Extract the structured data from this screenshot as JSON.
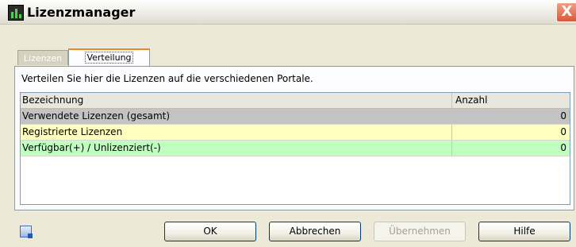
{
  "window": {
    "title": "Lizenzmanager",
    "close_label": "X"
  },
  "tabs": [
    {
      "label": "Lizenzen",
      "active": false
    },
    {
      "label": "Verteilung",
      "active": true
    }
  ],
  "panel": {
    "description": "Verteilen Sie hier die Lizenzen auf die verschiedenen Portale."
  },
  "grid": {
    "columns": [
      "Bezeichnung",
      "Anzahl"
    ],
    "rows": [
      {
        "label": "Verwendete Lizenzen (gesamt)",
        "value": "0",
        "color": "#c3c3c3"
      },
      {
        "label": "Registrierte Lizenzen",
        "value": "0",
        "color": "#ffffc0"
      },
      {
        "label": "Verfügbar(+) / Unlizenziert(-)",
        "value": "0",
        "color": "#c0ffc0"
      }
    ]
  },
  "buttons": {
    "ok": "OK",
    "cancel": "Abbrechen",
    "apply": "Übernehmen",
    "help": "Hilfe"
  },
  "icons": {
    "app": "app-icon",
    "help_corner": "help-corner-icon"
  },
  "colors": {
    "active_tab_accent": "#e68b2c",
    "close_button": "#d8583a"
  }
}
